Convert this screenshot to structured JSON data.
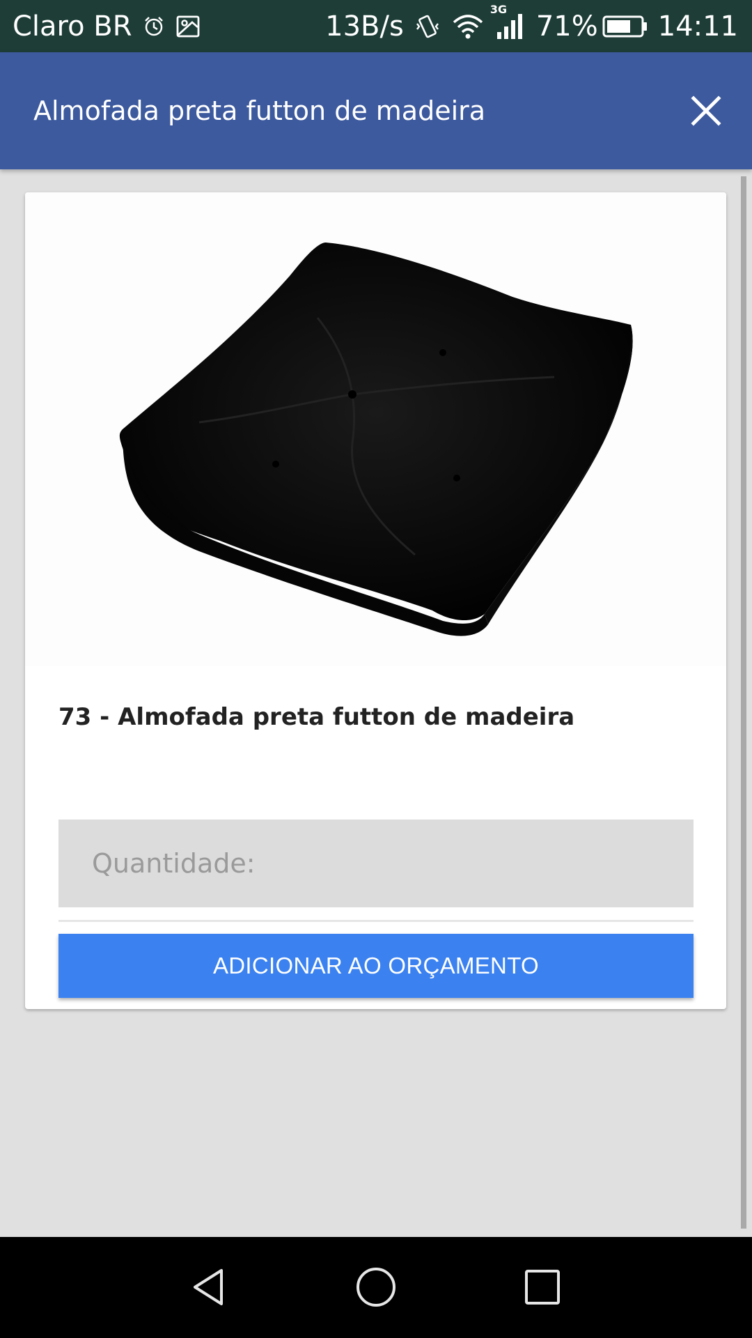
{
  "status_bar": {
    "carrier": "Claro BR",
    "net_speed": "13B/s",
    "network_type": "3G",
    "battery_percent": "71%",
    "battery_level": 0.71,
    "time": "14:11",
    "icons": [
      "alarm-icon",
      "gallery-icon",
      "vibrate-icon",
      "wifi-icon",
      "signal-icon",
      "battery-icon"
    ]
  },
  "app_bar": {
    "title": "Almofada preta futton de madeira",
    "close_icon": "close-icon",
    "color": "#3d5a9e"
  },
  "product": {
    "image": "black-futon-cushion",
    "title": "73 - Almofada preta futton de madeira"
  },
  "form": {
    "quantity_placeholder": "Quantidade:",
    "quantity_value": "",
    "add_button_label": "ADICIONAR AO ORÇAMENTO",
    "button_color": "#3b82f0"
  },
  "nav_bar": {
    "icons": [
      "back-icon",
      "home-icon",
      "recents-icon"
    ]
  }
}
